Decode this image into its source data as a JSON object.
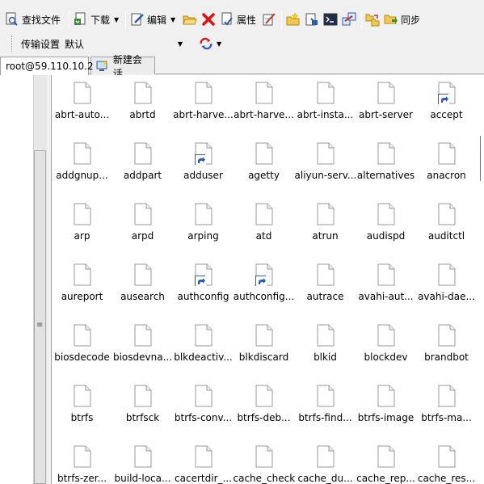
{
  "toolbar": {
    "find_file": "查找文件",
    "download": "下载",
    "edit": "编辑",
    "properties": "属性",
    "sync": "同步"
  },
  "profile": {
    "label": "传输设置",
    "value": "默认"
  },
  "tabs": [
    {
      "label": "root@59.110.10.2"
    },
    {
      "label": "新建会话"
    }
  ],
  "files": [
    {
      "name": "abrt-auto...",
      "shortcut": false
    },
    {
      "name": "abrtd",
      "shortcut": false
    },
    {
      "name": "abrt-harve...",
      "shortcut": false
    },
    {
      "name": "abrt-harve...",
      "shortcut": false
    },
    {
      "name": "abrt-insta...",
      "shortcut": false
    },
    {
      "name": "abrt-server",
      "shortcut": false
    },
    {
      "name": "accept",
      "shortcut": true
    },
    {
      "name": "addgnup...",
      "shortcut": false
    },
    {
      "name": "addpart",
      "shortcut": false
    },
    {
      "name": "adduser",
      "shortcut": true
    },
    {
      "name": "agetty",
      "shortcut": false
    },
    {
      "name": "aliyun-serv...",
      "shortcut": false
    },
    {
      "name": "alternatives",
      "shortcut": false
    },
    {
      "name": "anacron",
      "shortcut": false
    },
    {
      "name": "arp",
      "shortcut": false
    },
    {
      "name": "arpd",
      "shortcut": false
    },
    {
      "name": "arping",
      "shortcut": false
    },
    {
      "name": "atd",
      "shortcut": false
    },
    {
      "name": "atrun",
      "shortcut": false
    },
    {
      "name": "audispd",
      "shortcut": false
    },
    {
      "name": "auditctl",
      "shortcut": false
    },
    {
      "name": "aureport",
      "shortcut": false
    },
    {
      "name": "ausearch",
      "shortcut": false
    },
    {
      "name": "authconfig",
      "shortcut": true
    },
    {
      "name": "authconfig...",
      "shortcut": true
    },
    {
      "name": "autrace",
      "shortcut": false
    },
    {
      "name": "avahi-aut...",
      "shortcut": false
    },
    {
      "name": "avahi-dae...",
      "shortcut": false
    },
    {
      "name": "biosdecode",
      "shortcut": false
    },
    {
      "name": "biosdevna...",
      "shortcut": false
    },
    {
      "name": "blkdeactiv...",
      "shortcut": false
    },
    {
      "name": "blkdiscard",
      "shortcut": false
    },
    {
      "name": "blkid",
      "shortcut": false
    },
    {
      "name": "blockdev",
      "shortcut": false
    },
    {
      "name": "brandbot",
      "shortcut": false
    },
    {
      "name": "btrfs",
      "shortcut": false
    },
    {
      "name": "btrfsck",
      "shortcut": false
    },
    {
      "name": "btrfs-conv...",
      "shortcut": false
    },
    {
      "name": "btrfs-deb...",
      "shortcut": false
    },
    {
      "name": "btrfs-find...",
      "shortcut": false
    },
    {
      "name": "btrfs-image",
      "shortcut": false
    },
    {
      "name": "btrfs-ma...",
      "shortcut": false
    },
    {
      "name": "btrfs-zer...",
      "shortcut": false
    },
    {
      "name": "build-loca...",
      "shortcut": false
    },
    {
      "name": "cacertdir_...",
      "shortcut": false
    },
    {
      "name": "cache_check",
      "shortcut": false
    },
    {
      "name": "cache_du...",
      "shortcut": false
    },
    {
      "name": "cache_rep...",
      "shortcut": false
    },
    {
      "name": "cache_res...",
      "shortcut": false
    }
  ]
}
